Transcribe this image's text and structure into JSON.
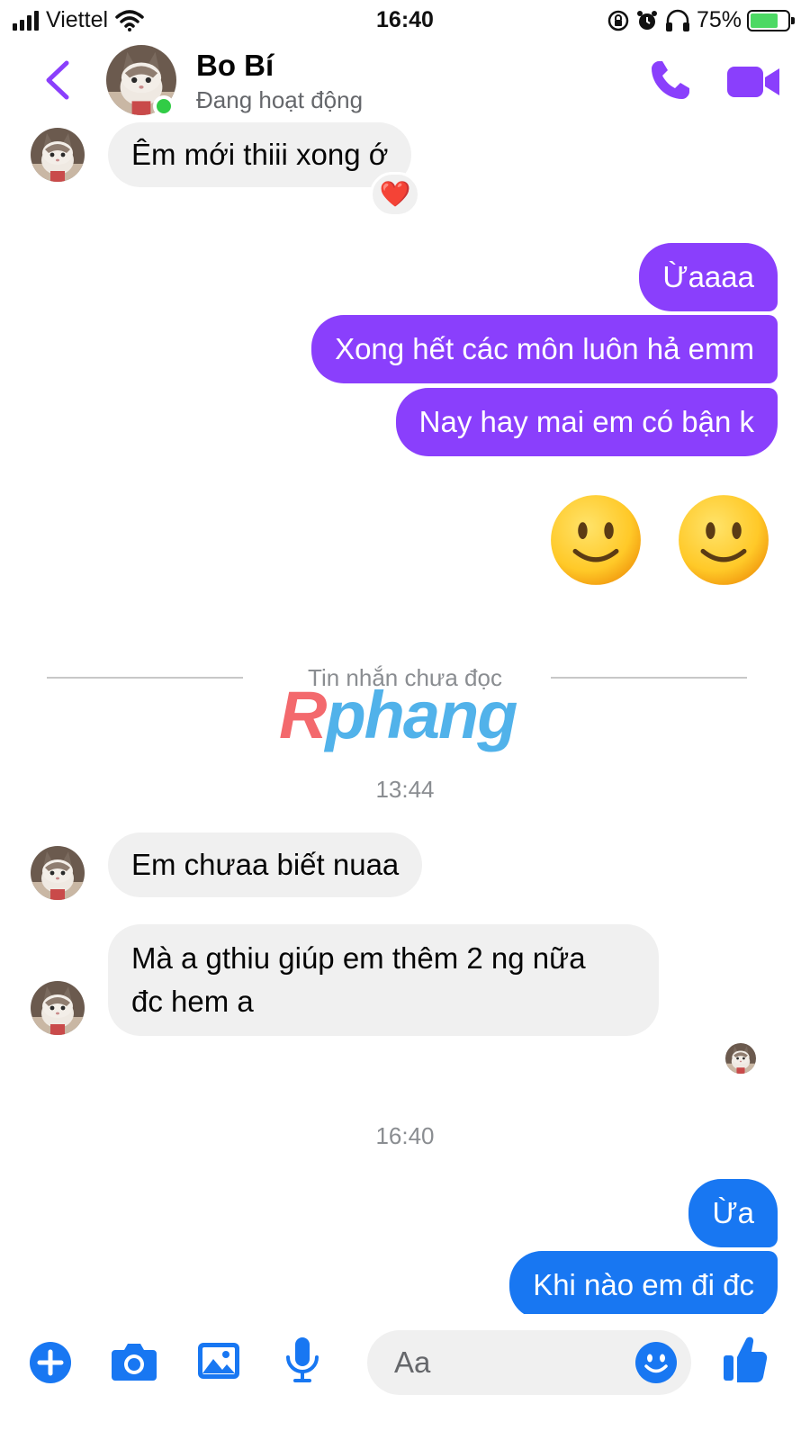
{
  "status_bar": {
    "carrier": "Viettel",
    "time": "16:40",
    "battery": "75%",
    "battery_level": 0.75
  },
  "header": {
    "name": "Bo Bí",
    "status": "Đang hoạt động",
    "online": true
  },
  "messages": {
    "in_1": "Êm mới thiii xong ớ",
    "in_1_reaction": "❤️",
    "out_1": "Ừaaaa",
    "out_2": "Xong hết các môn luôn hả emm",
    "out_3": "Nay hay mai em có bận k",
    "out_emoji_1": "🙂",
    "out_emoji_2": "🙂",
    "unread_divider": "Tin nhắn chưa đọc",
    "watermark": {
      "first": "R",
      "rest": "phang"
    },
    "time_1": "13:44",
    "in_2": "Em chưaa biết nuaa",
    "in_3_line1": "Mà a gthiu giúp em thêm 2 ng nữa",
    "in_3_line2": "đc hem a",
    "time_2": "16:40",
    "out_4": "Ừa",
    "out_5": "Khi nào em đi đc"
  },
  "composer": {
    "placeholder": "Aa"
  },
  "colors": {
    "accent_purple": "#8a3ffc",
    "accent_blue": "#1877f2",
    "incoming_bg": "#f0f0f0",
    "online_green": "#31cc46"
  },
  "icons": {
    "back": "chevron-left-icon",
    "call": "phone-icon",
    "video": "video-camera-icon",
    "add": "plus-icon",
    "camera": "camera-icon",
    "gallery": "image-icon",
    "mic": "microphone-icon",
    "emoji": "smiley-icon",
    "like": "thumbs-up-icon"
  }
}
